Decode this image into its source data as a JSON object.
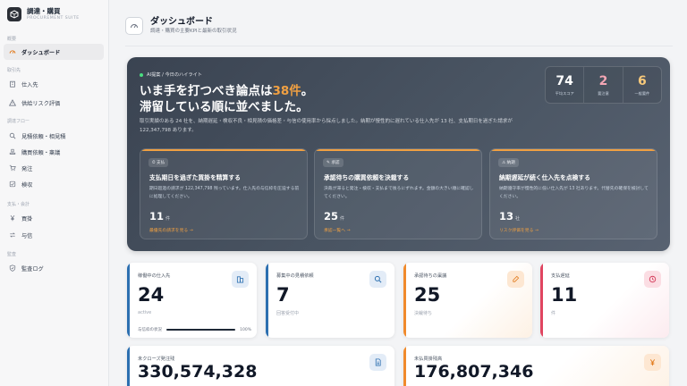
{
  "brand": {
    "title": "調達・購買",
    "subtitle": "PROCUREMENT SUITE"
  },
  "nav": {
    "section_overview": "概要",
    "dashboard": "ダッシュボード",
    "section_partners": "取引先",
    "suppliers": "仕入先",
    "supplier_risk": "供給リスク評価",
    "section_flow": "調達フロー",
    "quote_requests": "見積依頼・相見積",
    "purchase_requests": "購買依頼・稟議",
    "orders": "発注",
    "inspection": "検収",
    "section_payment": "支払・会計",
    "purchases": "買掛",
    "payments": "与信",
    "section_audit": "監査",
    "audit_log": "監査ログ"
  },
  "header": {
    "title": "ダッシュボード",
    "subtitle": "調達・購買の主要KPIと最新の取引状況"
  },
  "hero": {
    "label": "AI提案 / 今日のハイライト",
    "title_prefix": "いま手を打つべき論点は",
    "title_highlight": "38件",
    "title_suffix": "。",
    "title_line2": "滞留している順に並べました。",
    "description": "取引実績のある 24 社を、納期遅延・検収不良・相見積の価格差・与信の使用率から採点しました。納期が慢性的に遅れている仕入先が 13 社、支払期日を過ぎた請求が 122,347,798 あります。",
    "stats": [
      {
        "value": "74",
        "label": "平均スコア",
        "color": "#ffffff"
      },
      {
        "value": "2",
        "label": "要注意",
        "color": "#f3a6b4"
      },
      {
        "value": "6",
        "label": "一般要件",
        "color": "#f7c97a"
      }
    ],
    "cards": [
      {
        "tag": "支払",
        "title": "支払期日を過ぎた買掛を精算する",
        "desc": "期日超過の請求が 122,347,798 残っています。仕入先の与信枠を圧迫する前に処理してください。",
        "value": "11",
        "unit": "件",
        "link": "最優先の請求を見る →"
      },
      {
        "tag": "承認",
        "title": "承認待ちの購買依頼を決裁する",
        "desc": "決裁が滞ると発注・検収・支払まで後ろにずれます。金額の大きい順に確認してください。",
        "value": "25",
        "unit": "件",
        "link": "承認一覧へ →"
      },
      {
        "tag": "納期",
        "title": "納期遅延が続く仕入先を点検する",
        "desc": "納期遵守率が慢性的に低い仕入先が 13 社あります。代替先の確保を検討してください。",
        "value": "13",
        "unit": "社",
        "link": "リスク評価を見る →"
      }
    ]
  },
  "kpis": [
    {
      "label": "稼働中の仕入先",
      "value": "24",
      "sub": "active",
      "icon": "building-icon",
      "progress_label": "与信枠の状況",
      "progress_value": "100%",
      "progress_fraction": 1.0
    },
    {
      "label": "募集中の見積依頼",
      "value": "7",
      "sub": "回答受付中",
      "icon": "search-icon"
    },
    {
      "label": "承認待ちの稟議",
      "value": "25",
      "sub": "決裁待ち",
      "icon": "stamp-icon"
    },
    {
      "label": "支払遅延",
      "value": "11",
      "sub": "件",
      "icon": "clock-icon"
    },
    {
      "label": "未クローズ発注残",
      "value": "330,574,328",
      "icon": "document-icon"
    },
    {
      "label": "未払買掛残高",
      "value": "176,807,346",
      "icon": "yen-icon"
    }
  ]
}
